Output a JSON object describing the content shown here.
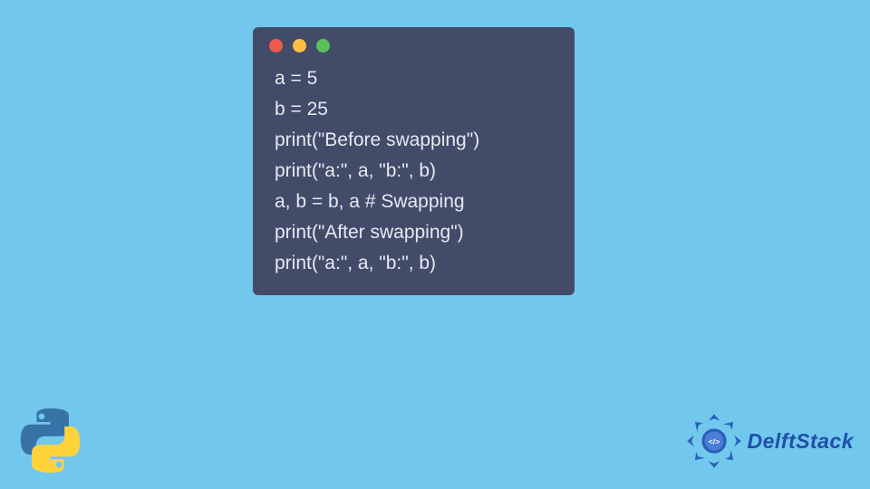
{
  "code": {
    "lines": [
      "a = 5",
      "b = 25",
      "print(\"Before swapping\")",
      "print(\"a:\", a, \"b:\", b)",
      "a, b = b, a # Swapping",
      "print(\"After swapping\")",
      "print(\"a:\", a, \"b:\", b)"
    ]
  },
  "window": {
    "dot_colors": {
      "red": "#ed594a",
      "yellow": "#fdbd41",
      "green": "#5ac05a"
    }
  },
  "branding": {
    "site_name": "DelftStack",
    "language": "Python"
  },
  "colors": {
    "page_bg": "#72c7ed",
    "window_bg": "#424c69",
    "code_fg": "#e6e9f1",
    "brand_blue": "#1f4fa8"
  }
}
